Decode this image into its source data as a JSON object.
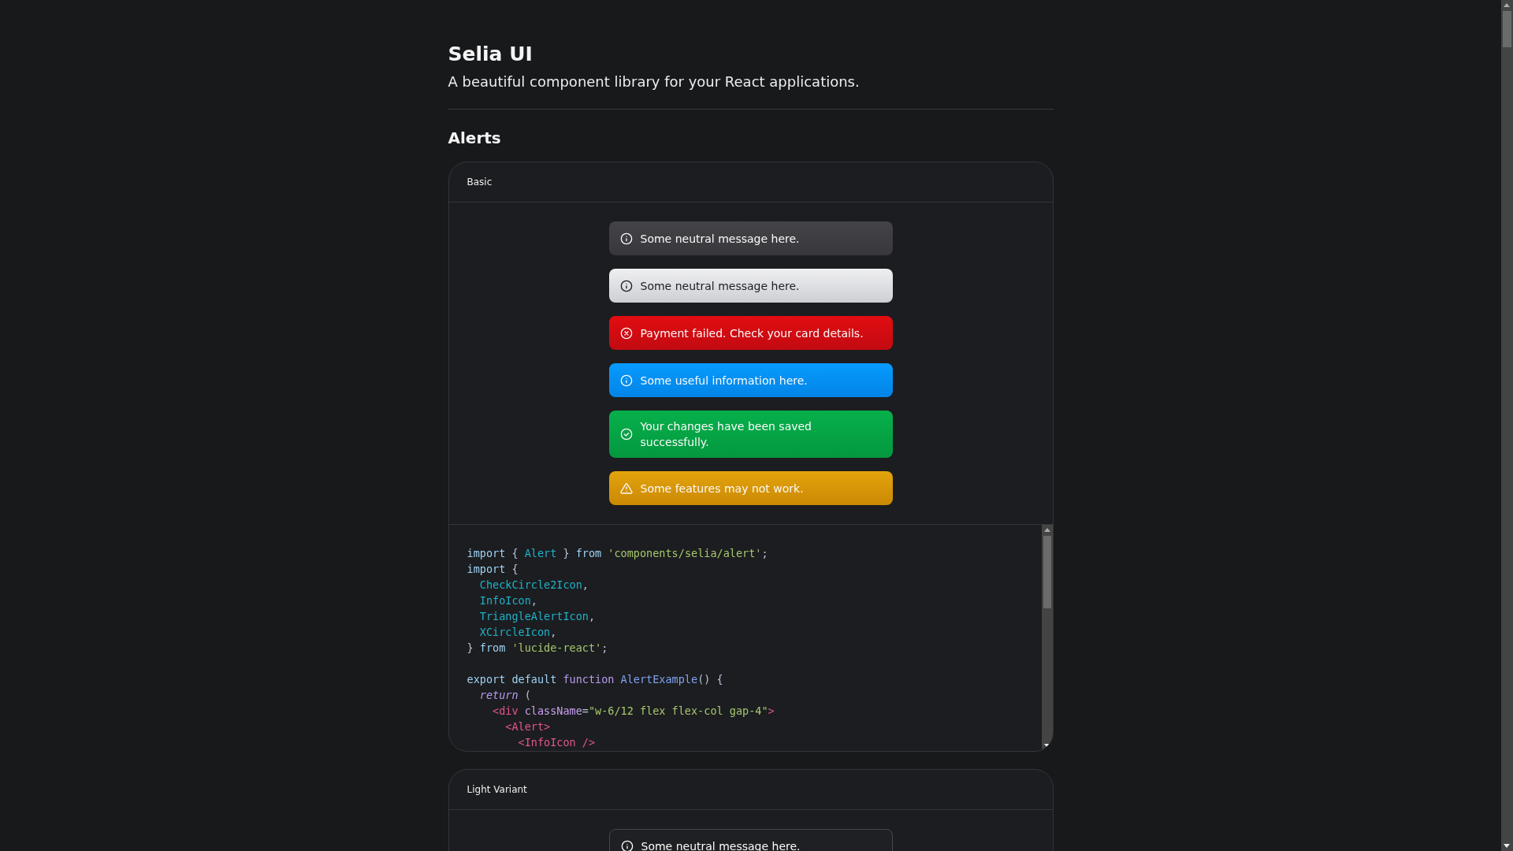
{
  "header": {
    "title": "Selia UI",
    "subtitle": "A beautiful component library for your React applications."
  },
  "section": {
    "title": "Alerts"
  },
  "examples": [
    {
      "title": "Basic",
      "alerts": [
        {
          "kind": "neutral-dark",
          "text": "Some neutral message here."
        },
        {
          "kind": "neutral-light",
          "text": "Some neutral message here."
        },
        {
          "kind": "error",
          "text": "Payment failed. Check your card details."
        },
        {
          "kind": "info",
          "text": "Some useful information here."
        },
        {
          "kind": "success",
          "text": "Your changes have been saved successfully."
        },
        {
          "kind": "warning",
          "text": "Some features may not work."
        }
      ],
      "code": [
        {
          "kind": "code",
          "tokens": [
            {
              "t": "import ",
              "kind": "keyword"
            },
            {
              "t": "{ ",
              "kind": "punct"
            },
            {
              "t": "Alert",
              "kind": "identifier"
            },
            {
              "t": " } ",
              "kind": "punct"
            },
            {
              "t": "from ",
              "kind": "keyword"
            },
            {
              "t": "'components/selia/alert'",
              "kind": "string"
            },
            {
              "t": ";",
              "kind": "punct"
            }
          ]
        },
        {
          "kind": "code",
          "tokens": [
            {
              "t": "import ",
              "kind": "keyword"
            },
            {
              "t": "{",
              "kind": "punct"
            }
          ]
        },
        {
          "kind": "code",
          "tokens": [
            {
              "t": "  CheckCircle2Icon",
              "kind": "identifier"
            },
            {
              "t": ",",
              "kind": "punct"
            }
          ]
        },
        {
          "kind": "code",
          "tokens": [
            {
              "t": "  InfoIcon",
              "kind": "identifier"
            },
            {
              "t": ",",
              "kind": "punct"
            }
          ]
        },
        {
          "kind": "code",
          "tokens": [
            {
              "t": "  TriangleAlertIcon",
              "kind": "identifier"
            },
            {
              "t": ",",
              "kind": "punct"
            }
          ]
        },
        {
          "kind": "code",
          "tokens": [
            {
              "t": "  XCircleIcon",
              "kind": "identifier"
            },
            {
              "t": ",",
              "kind": "punct"
            }
          ]
        },
        {
          "kind": "code",
          "tokens": [
            {
              "t": "} ",
              "kind": "punct"
            },
            {
              "t": "from ",
              "kind": "keyword"
            },
            {
              "t": "'lucide-react'",
              "kind": "string"
            },
            {
              "t": ";",
              "kind": "punct"
            }
          ]
        },
        {
          "kind": "blank"
        },
        {
          "kind": "code",
          "tokens": [
            {
              "t": "export default ",
              "kind": "keyword"
            },
            {
              "t": "function ",
              "kind": "function"
            },
            {
              "t": "AlertExample",
              "kind": "name"
            },
            {
              "t": "() {",
              "kind": "punct"
            }
          ]
        },
        {
          "kind": "code",
          "tokens": [
            {
              "t": "  return",
              "kind": "return"
            },
            {
              "t": " (",
              "kind": "punct"
            }
          ]
        },
        {
          "kind": "code",
          "tokens": [
            {
              "t": "    <div ",
              "kind": "tag"
            },
            {
              "t": "className",
              "kind": "attribute"
            },
            {
              "t": "=",
              "kind": "punct"
            },
            {
              "t": "\"w-6/12 flex flex-col gap-4\"",
              "kind": "string"
            },
            {
              "t": ">",
              "kind": "tag"
            }
          ]
        },
        {
          "kind": "code",
          "tokens": [
            {
              "t": "      <Alert>",
              "kind": "tag"
            }
          ]
        },
        {
          "kind": "code",
          "tokens": [
            {
              "t": "        <InfoIcon />",
              "kind": "tag"
            }
          ]
        }
      ]
    },
    {
      "title": "Light Variant",
      "alerts": [
        {
          "kind": "outline",
          "text": "Some neutral message here."
        }
      ]
    }
  ]
}
